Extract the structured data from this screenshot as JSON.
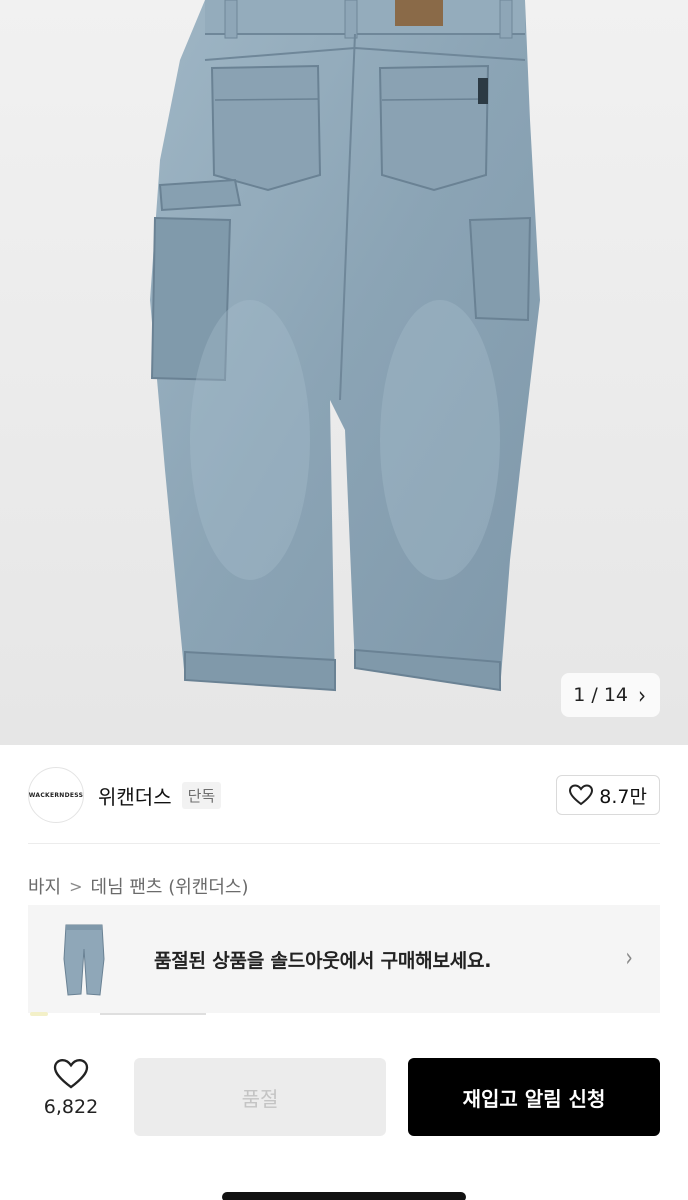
{
  "gallery": {
    "current": "1",
    "separator": "/",
    "total": "14",
    "next_icon": "chevron-right-icon",
    "subject": "light-wash denim carpenter pants, back view"
  },
  "brand": {
    "logo_text": "WACKERNDESS",
    "name": "위캔더스",
    "badge": "단독",
    "likes": "8.7만",
    "heart_icon": "heart-outline-icon"
  },
  "breadcrumb": {
    "items": [
      "바지",
      "데님 팬츠 (위캔더스)"
    ],
    "separator": ">"
  },
  "soldout_banner": {
    "text": "품절된 상품을 솔드아웃에서 구매해보세요.",
    "chevron": "›"
  },
  "action_bar": {
    "like_count": "6,822",
    "soldout_label": "품절",
    "notify_label": "재입고 알림 신청"
  },
  "colors": {
    "denim": "#8fa7b8",
    "denim_dark": "#6f8a9e",
    "banner_bg": "#f5f5f5",
    "primary_button": "#000000",
    "disabled_button": "#ececec"
  }
}
